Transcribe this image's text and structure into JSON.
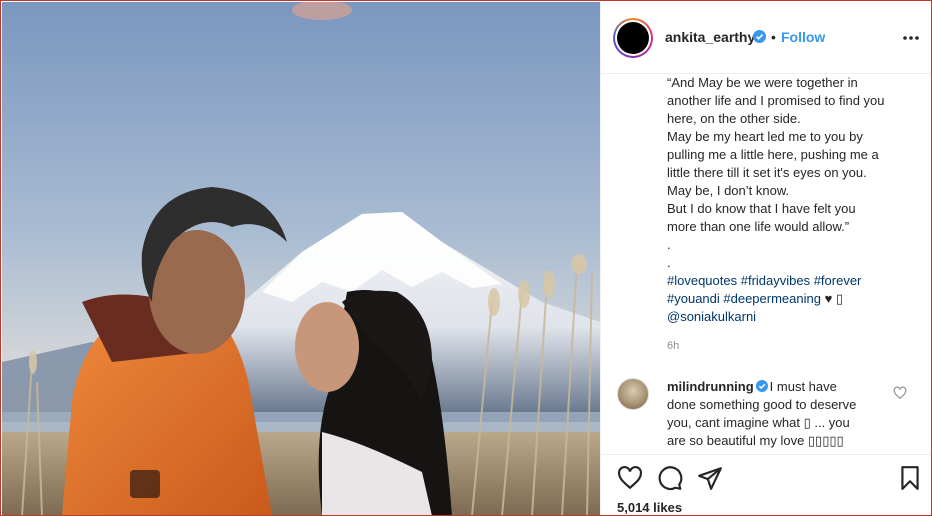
{
  "post": {
    "username": "ankita_earthy",
    "separator": "•",
    "follow_label": "Follow",
    "caption_lines": [
      "“And May be we were together in",
      "another life and I promised to find you",
      "here, on the other side.",
      "May be my heart led me to you by",
      "pulling me a little here, pushing me a",
      "little there till it set it's eyes on you.",
      "May be, I don’t know.",
      "But I do know that I have felt you",
      "more than one life would allow.”",
      ".",
      "."
    ],
    "hashtags_line1": "#lovequotes #fridayvibes #forever",
    "hashtags_line2_tags": "#youandi #deepermeaning",
    "hashtags_line2_suffix": " ♥ ▯",
    "mention": "@soniakulkarni",
    "time_ago": "6h",
    "likes": "5,014 likes"
  },
  "comment": {
    "username": "milindrunning",
    "lines": [
      "I must have",
      "done something good to deserve",
      "you, cant imagine what ▯ ... you",
      "are so beautiful my love ▯▯▯▯▯"
    ]
  },
  "icons": {
    "like": "heart-icon",
    "comment": "comment-icon",
    "share": "share-icon",
    "save": "bookmark-icon",
    "more": "more-options-icon",
    "verified": "verified-badge-icon"
  },
  "colors": {
    "follow": "#3897f0",
    "verified": "#3897f0",
    "hashtag": "#00376b",
    "jacket": "#e8742c"
  }
}
